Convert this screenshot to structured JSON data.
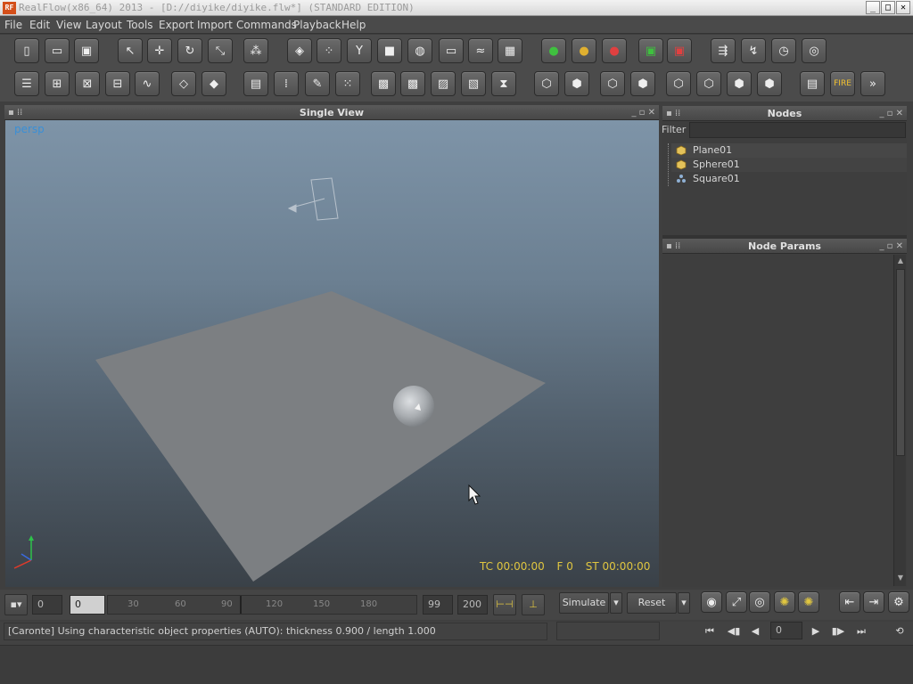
{
  "window": {
    "title": "RealFlow(x86_64) 2013 - [D://diyike/diyike.flw*] (STANDARD EDITION)",
    "app_icon_text": "RF",
    "controls": {
      "minimize": "_",
      "maximize": "□",
      "close": "✕"
    }
  },
  "menu": [
    "File",
    "Edit",
    "View",
    "Layout",
    "Tools",
    "Export",
    "Import",
    "Commands",
    "Playback",
    "Help"
  ],
  "toolbar_row1": [
    {
      "name": "new-scene-icon",
      "glyph": "▯"
    },
    {
      "name": "open-scene-icon",
      "glyph": "▭"
    },
    {
      "name": "save-scene-icon",
      "glyph": "▣"
    },
    {
      "name": "select-tool-icon",
      "glyph": "↖"
    },
    {
      "name": "move-tool-icon",
      "glyph": "✛"
    },
    {
      "name": "rotate-tool-icon",
      "glyph": "↻"
    },
    {
      "name": "scale-tool-icon",
      "glyph": "⤡"
    },
    {
      "name": "link-tool-icon",
      "glyph": "⁂"
    },
    {
      "name": "add-emitter-icon",
      "glyph": "◈"
    },
    {
      "name": "add-particles-icon",
      "glyph": "⁘"
    },
    {
      "name": "add-daemon-icon",
      "glyph": "Y"
    },
    {
      "name": "add-object-icon",
      "glyph": "■"
    },
    {
      "name": "add-mesh-icon",
      "glyph": "◍"
    },
    {
      "name": "add-camera-icon",
      "glyph": "▭"
    },
    {
      "name": "add-wave-icon",
      "glyph": "≈"
    },
    {
      "name": "add-rigidbody-icon",
      "glyph": "▦"
    },
    {
      "name": "simulate-green-icon",
      "glyph": "●"
    },
    {
      "name": "simulate-yellow-icon",
      "glyph": "●"
    },
    {
      "name": "simulate-red-icon",
      "glyph": "●"
    },
    {
      "name": "export-green-icon",
      "glyph": "▣"
    },
    {
      "name": "export-red-icon",
      "glyph": "▣"
    },
    {
      "name": "batch-play-icon",
      "glyph": "⇶"
    },
    {
      "name": "script-play-icon",
      "glyph": "↯"
    },
    {
      "name": "timer-play-icon",
      "glyph": "◷"
    },
    {
      "name": "render-play-icon",
      "glyph": "◎"
    }
  ],
  "toolbar_row2": [
    {
      "name": "layout-list-icon",
      "glyph": "☰"
    },
    {
      "name": "layout-grid-icon",
      "glyph": "⊞"
    },
    {
      "name": "layout-scale-icon",
      "glyph": "⊠"
    },
    {
      "name": "layout-graph-icon",
      "glyph": "⊟"
    },
    {
      "name": "layout-curve-icon",
      "glyph": "∿"
    },
    {
      "name": "view-cube-icon",
      "glyph": "◇"
    },
    {
      "name": "view-box-icon",
      "glyph": "◆"
    },
    {
      "name": "node-list-icon",
      "glyph": "▤"
    },
    {
      "name": "channels-icon",
      "glyph": "⁞"
    },
    {
      "name": "notes-icon",
      "glyph": "✎"
    },
    {
      "name": "particles-grid-icon",
      "glyph": "⁙"
    },
    {
      "name": "texture-a-icon",
      "glyph": "▩"
    },
    {
      "name": "texture-b-icon",
      "glyph": "▩"
    },
    {
      "name": "texture-c-icon",
      "glyph": "▨"
    },
    {
      "name": "texture-d-icon",
      "glyph": "▧"
    },
    {
      "name": "hourglass-icon",
      "glyph": "⧗"
    },
    {
      "name": "hex-a-icon",
      "glyph": "⬡"
    },
    {
      "name": "hex-b-icon",
      "glyph": "⬢"
    },
    {
      "name": "hex-c-icon",
      "glyph": "⬡"
    },
    {
      "name": "hex-d-icon",
      "glyph": "⬢"
    },
    {
      "name": "cube-a-icon",
      "glyph": "⬡"
    },
    {
      "name": "cube-b-icon",
      "glyph": "⬡"
    },
    {
      "name": "cube-c-icon",
      "glyph": "⬢"
    },
    {
      "name": "cube-d-icon",
      "glyph": "⬢"
    },
    {
      "name": "render-settings-icon",
      "glyph": "▤"
    },
    {
      "name": "fire-icon",
      "glyph": "FIRE"
    },
    {
      "name": "external-icon",
      "glyph": "»"
    }
  ],
  "views": {
    "single_view_title": "Single View",
    "camera_label": "persp",
    "hud": {
      "tc": "TC 00:00:00",
      "frame": "F 0",
      "st": "ST 00:00:00"
    }
  },
  "nodes_panel": {
    "title": "Nodes",
    "filter_label": "Filter",
    "filter_value": "",
    "items": [
      {
        "label": "Plane01",
        "icon": "object-cube-icon"
      },
      {
        "label": "Sphere01",
        "icon": "object-cube-icon"
      },
      {
        "label": "Square01",
        "icon": "emitter-dots-icon"
      }
    ]
  },
  "node_params_panel": {
    "title": "Node Params"
  },
  "timeline": {
    "start_field": "0",
    "current_field": "0",
    "ticks": [
      "30",
      "60",
      "90",
      "120",
      "150",
      "180"
    ],
    "end_field": "99",
    "max_field": "200",
    "simulate_label": "Simulate",
    "reset_label": "Reset"
  },
  "status": {
    "message": "[Caronte] Using characteristic object properties (AUTO): thickness 0.900 / length 1.000",
    "playback_frame": "0"
  },
  "colors": {
    "accent_hud": "#e0c640",
    "viewport_top": "#7e94a8",
    "viewport_bottom": "#3a4148",
    "panel_bg": "#3e3e3e"
  }
}
